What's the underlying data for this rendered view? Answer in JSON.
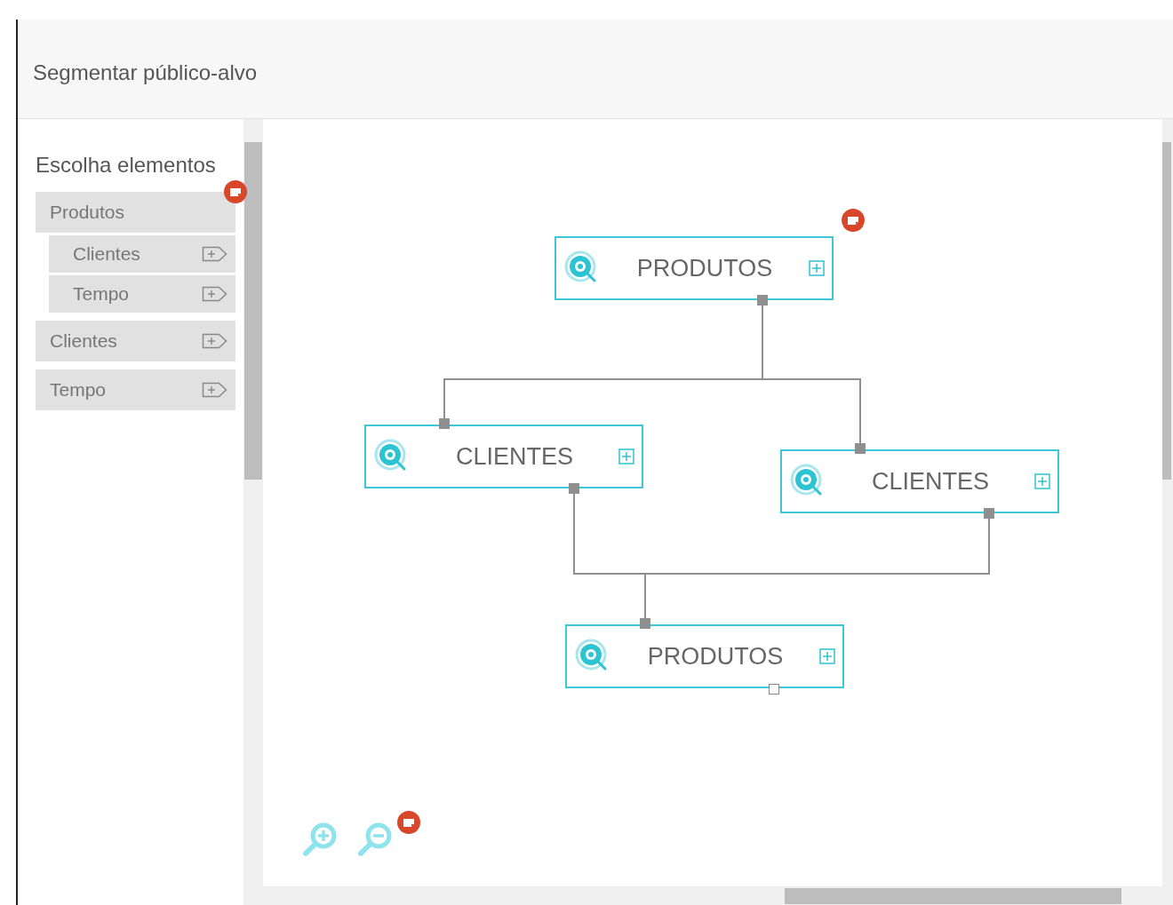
{
  "window": {
    "title": "Segmentar público-alvo"
  },
  "sidebar": {
    "heading": "Escolha elementos",
    "items": [
      {
        "label": "Produtos",
        "children": [
          {
            "label": "Clientes"
          },
          {
            "label": "Tempo"
          }
        ]
      },
      {
        "label": "Clientes"
      },
      {
        "label": "Tempo"
      }
    ]
  },
  "diagram": {
    "nodes": [
      {
        "label": "PRODUTOS"
      },
      {
        "label": "CLIENTES"
      },
      {
        "label": "CLIENTES"
      },
      {
        "label": "PRODUTOS"
      }
    ]
  }
}
